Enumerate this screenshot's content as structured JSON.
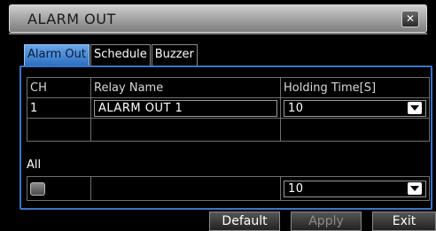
{
  "window": {
    "title": "ALARM OUT",
    "close_glyph": "✕"
  },
  "tabs": [
    {
      "label": "Alarm Out",
      "active": true
    },
    {
      "label": "Schedule",
      "active": false
    },
    {
      "label": "Buzzer",
      "active": false
    }
  ],
  "table": {
    "headers": [
      "CH",
      "Relay Name",
      "Holding Time[S]"
    ],
    "rows": [
      {
        "ch": "1",
        "relay_name": "ALARM OUT 1",
        "holding_time": "10"
      }
    ]
  },
  "all": {
    "label": "All",
    "holding_time": "10",
    "checked": false
  },
  "buttons": {
    "default": "Default",
    "apply": "Apply",
    "exit": "Exit"
  },
  "colors": {
    "accent": "#3b74c8",
    "active_tab": "#4f8fd8",
    "title_bar": "#a8a8a8"
  }
}
